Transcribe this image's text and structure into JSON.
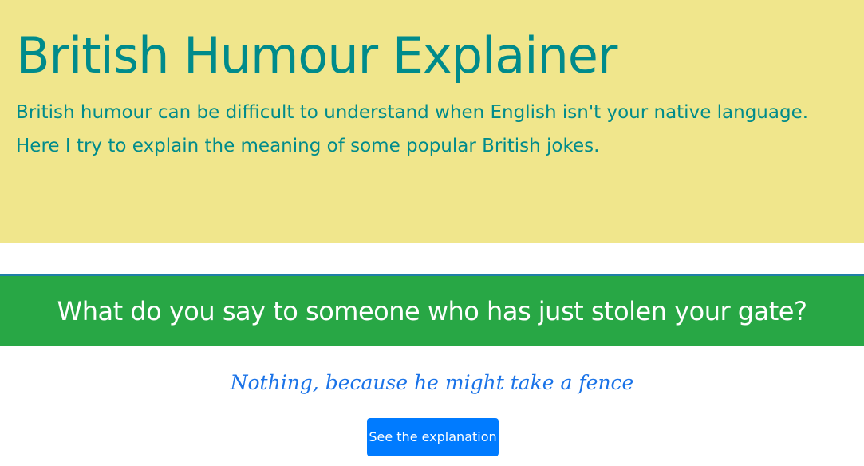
{
  "hero": {
    "title": "British Humour Explainer",
    "lead": "British humour can be difficult to understand when English isn't your native language. Here I try to explain the meaning of some popular British jokes.",
    "background_color": "#f0e68c",
    "text_color": "#008b8b"
  },
  "joke": {
    "question": "What do you say to someone who has just stolen your gate?",
    "answer": "Nothing, because he might take a fence",
    "button_label": "See the explanation",
    "header_color": "#28a745",
    "answer_color": "#1a73e8",
    "button_color": "#007bff"
  }
}
